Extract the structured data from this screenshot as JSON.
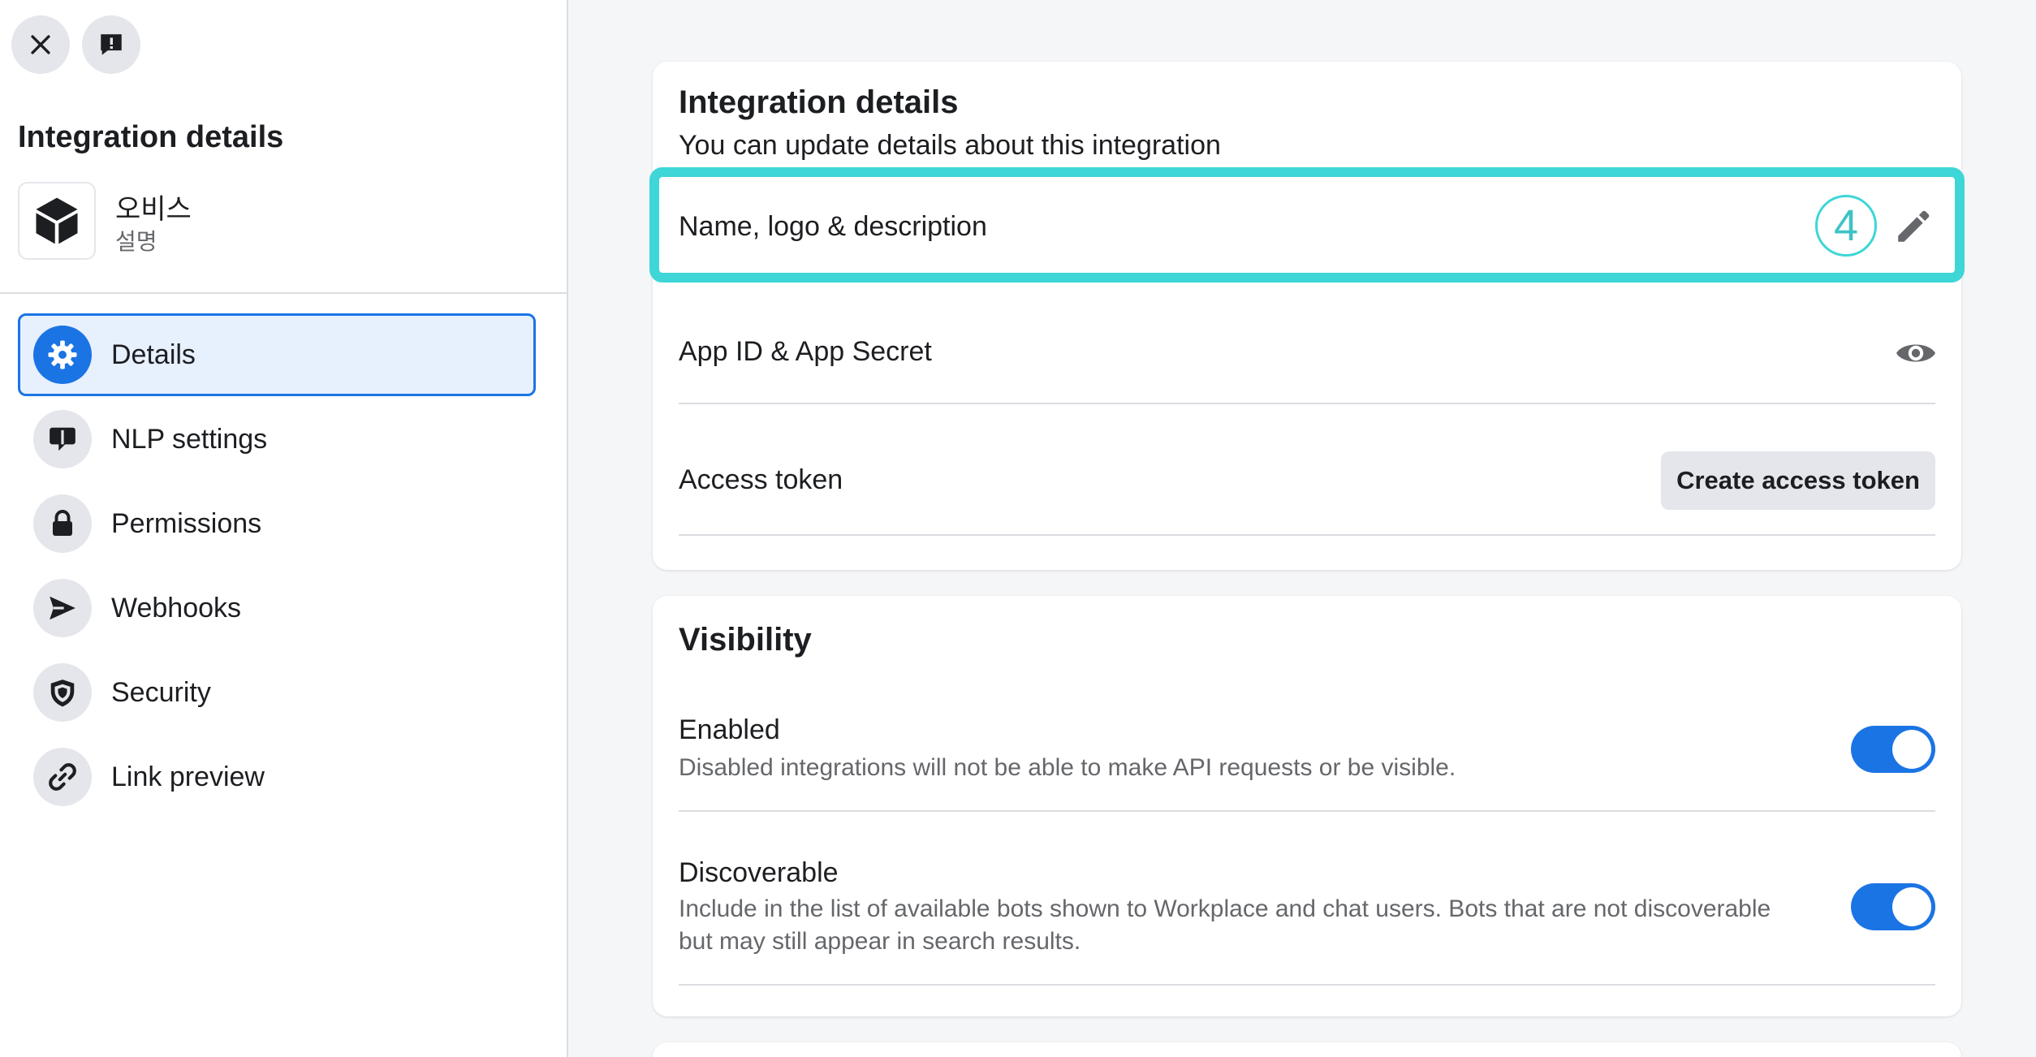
{
  "sidebar": {
    "title": "Integration details",
    "app": {
      "name": "오비스",
      "description": "설명"
    },
    "items": [
      {
        "label": "Details",
        "icon": "gear-icon",
        "active": true
      },
      {
        "label": "NLP settings",
        "icon": "speech-bubble-icon",
        "active": false
      },
      {
        "label": "Permissions",
        "icon": "lock-icon",
        "active": false
      },
      {
        "label": "Webhooks",
        "icon": "send-icon",
        "active": false
      },
      {
        "label": "Security",
        "icon": "shield-icon",
        "active": false
      },
      {
        "label": "Link preview",
        "icon": "link-icon",
        "active": false
      }
    ]
  },
  "details_card": {
    "title": "Integration details",
    "subtitle": "You can update details about this integration",
    "rows": {
      "name_logo": {
        "label": "Name, logo & description",
        "icon": "pencil-icon",
        "step": "4"
      },
      "app_id": {
        "label": "App ID & App Secret",
        "icon": "eye-icon"
      },
      "access_token": {
        "label": "Access token",
        "button": "Create access token"
      }
    }
  },
  "visibility_card": {
    "title": "Visibility",
    "enabled": {
      "title": "Enabled",
      "description": "Disabled integrations will not be able to make API requests or be visible.",
      "on": true
    },
    "discoverable": {
      "title": "Discoverable",
      "description": "Include in the list of available bots shown to Workplace and chat users. Bots that are not discoverable but may still appear in search results.",
      "on": true
    }
  },
  "colors": {
    "accent": "#1b74e4",
    "highlight": "#3ed6d7",
    "active_bg": "#e7f0fd"
  }
}
